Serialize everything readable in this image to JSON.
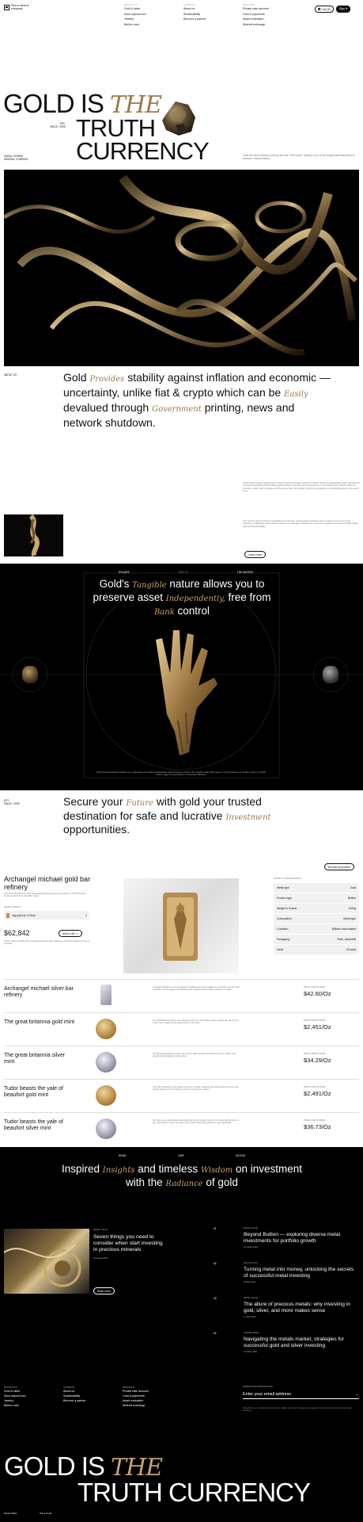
{
  "brand": {
    "line1": "Sierra mineral",
    "line2": "company"
  },
  "nav": {
    "products": {
      "head": "PRODUCTS",
      "items": [
        "Gold & silver",
        "Save deposit box",
        "Jewelry",
        "Bullion card"
      ]
    },
    "company": {
      "head": "COMPANY",
      "items": [
        "About us",
        "Sustainability",
        "Become a partner"
      ]
    },
    "services": {
      "head": "SERVICES",
      "items": [
        "Private safe account",
        "Card & payments",
        "Asset evaluation",
        "Mineral exchange"
      ]
    },
    "cart": "Cart (0)",
    "signin": "Sign in"
  },
  "hero": {
    "w1": "GOLD IS",
    "w2": "THE",
    "w3": "TRUTH",
    "w4": "CURRENCY",
    "est": "EST.",
    "since": "SINCE / 1995",
    "loc1": "IGADA / SHMRA",
    "loc2": "MINERAL COMPANY",
    "desc": "Gold has been used as currency for over 2,500 years, making it one of the longest-standing forms of money in human history."
  },
  "about": {
    "label": "ABOUT US",
    "t1": "Gold",
    "i1": "Provides",
    "t2": "stability against inflation and economic — uncertainty, unlike fiat & crypto which can be",
    "i2": "Easily",
    "t3": "devalued through",
    "i3": "Government",
    "t4": "printing, news and network shutdown.",
    "p1": "Gold's limited supply & physical form  ensures its enduring value, making it a reliable choice for safeguarding wealth. gold-backed currencies historically provide stability against inflation and economic uncertainty due to the limited supply of gold. Unlike fiat currencies, which can be printed at will by governments, the scarcity of gold is constrained by its physical presence in the earth's crust.",
    "p2": "This inherent scarcity tends to curb inflationary pressures, making gold an attractive store of value in times of economic turbulence. Additionally, gold's enduring status as a universally accepted form of currency enhances its role as a reliable hedge against financial volatility.",
    "learn": "Learn more"
  },
  "tangible": {
    "tags": [
      "ESCAPE",
      "FIAT &",
      "THE MATRIX"
    ],
    "h1": "Gold's",
    "i1": "Tangible",
    "h2": "nature allows you to preserve asset",
    "i2": "Independently,",
    "h3": "free from",
    "i3": "Bank",
    "h4": "control",
    "body": "Gold's physical presence enables you to safeguard your assets independently, without relying on banks. This tangible quality offers peace of mind, knowing your wealth is under your direct control, away from the influence of financial institutions."
  },
  "secure": {
    "est": "EST.",
    "since": "SINCE / 1995",
    "t1": "Secure your",
    "i1": "Future",
    "t2": "with gold your trusted destination for safe and lucrative",
    "i2": "Investment",
    "t3": "opportunities.",
    "browse": "Browse all product"
  },
  "featured": {
    "title": "Archangel michael gold bar refinery",
    "desc": "Insert from 99.99% pure gold, this elegantly designed investment piece is made from gold entirely sourced from Canadian mines.",
    "weight_label": "SELECT WEIGHT",
    "weight": "1kg gold bar 1.00ozs",
    "price": "$62,842",
    "add": "Add to cart",
    "note": "*Prices shown exclude VAT and shipping fees and are subject to market fluctuations at time of purchase.",
    "spec_head": "PRODUCT SPECIFICATIONS",
    "specs": [
      [
        "Metal type",
        "Gold"
      ],
      [
        "Product type",
        "Bullion"
      ],
      [
        "Weight in Grams",
        "1000g"
      ],
      [
        "Composition",
        "Metal type"
      ],
      [
        "Condition",
        "Brilliant uncirculated"
      ],
      [
        "Packaging",
        "Plate, clamshell"
      ],
      [
        "Karat",
        "24 karat"
      ]
    ]
  },
  "products": [
    {
      "name": "Archangel michael silver bar refinery",
      "desc": "Archangel Michael is a revered figure throughout the ancient religions as protector and the most powerful of all the angels, with Michael silver designs and precision execution is evident.",
      "price_label": "PRICE STARTS FROM",
      "price": "$42.60/Oz",
      "kind": "bar-silver"
    },
    {
      "name": "The great britannia gold mint",
      "desc": "The 2024 Britannia bullion coin redefines security in the bullion market, leading the way as one of the most visually secure bullion coins in the world.",
      "price_label": "PRICE STARTS FROM",
      "price": "$2,451/Oz",
      "kind": "coin-gold"
    },
    {
      "name": "The great britannia silver mint",
      "desc": "The Royal Mint Britannia series launched in 1987 and has remained one of the world's most popular and anticipated bullion series.",
      "price_label": "PRICE STARTS FROM",
      "price": "$34.29/Oz",
      "kind": "coin-silver"
    },
    {
      "name": "Tudor beasts the yale of beaufort gold mint",
      "desc": "The Yale of Beaufort is the second of the ten heraldic creatures that stand guard over the moat outside Hampton Court Palace in the form of fearsome statues.",
      "price_label": "PRICE STARTS FROM",
      "price": "$2,491/Oz",
      "kind": "coin-gold"
    },
    {
      "name": "Tudor beasts the yale of beaufort silver mint",
      "desc": "The Yale is a mythical beast resembling the body of a goat, the horns of a boar and the tail of a lion. The beast is shown wearing a crown collar which has signified its royal ownership.",
      "price_label": "PRICE STARTS FROM",
      "price": "$36.73/Oz",
      "kind": "coin-silver"
    }
  ],
  "blog": {
    "tags": [
      "READ",
      "OUR",
      "BLOGS"
    ],
    "h1": "Inspired",
    "i1": "Insights",
    "h2": "and timeless",
    "i2": "Wisdom",
    "h3": "on investment with the",
    "i3": "Radiance",
    "h4": "of gold",
    "feat_cat": "MONEY TALKS",
    "feat_title": "Seven things you need to consider when start investing in precious minerals",
    "feat_date": "12 August 2024",
    "read": "Read more",
    "feat_num": "01",
    "list": [
      {
        "num": "01",
        "cat": "MONEY TALKS",
        "title": "Beyond Bullion — exploring diverse metal investments for portfolio growth",
        "date": "12 August 2024"
      },
      {
        "num": "02",
        "cat": "BULLION TIPS",
        "title": "Turning metal into money, unlocking the secrets of successful metal investing",
        "date": "26 May 2024"
      },
      {
        "num": "03",
        "cat": "MONEY TALKS",
        "title": "The allure of precious metals: why investing in gold, silver, and more makes sense",
        "date": "17 April 2024"
      },
      {
        "num": "04",
        "cat": "GOLDEN NEWS",
        "title": "Navigating the metals market, strategies for successful gold and silver investing",
        "date": "31 March 2024"
      }
    ]
  },
  "footer": {
    "newsletter_head": "NEWSLETTER SUBSCRIPTION",
    "email_ph": "Enter your email address",
    "newsletter_note": "Subscribe to our newsletter for exclusive insights and expert updates on navigating the dynamic world of precious metal investing.",
    "big1": "GOLD IS",
    "big2": "THE",
    "big3": "TRUTH CURRENCY",
    "privacy": "Privacy Policy",
    "terms": "Terms of Use"
  },
  "colors": {
    "gold": "#9a7a4a",
    "dark": "#000000"
  }
}
